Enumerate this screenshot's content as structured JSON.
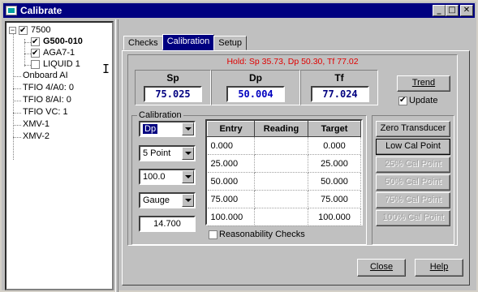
{
  "window": {
    "title": "Calibrate",
    "buttons": {
      "minimize": "_",
      "maximize": "□",
      "close": "✕"
    }
  },
  "tree": {
    "root": {
      "label": "7500",
      "checked": true
    },
    "items": [
      {
        "label": "G500-010",
        "checked": true,
        "bold": true
      },
      {
        "label": "AGA7-1",
        "checked": true,
        "bold": false
      },
      {
        "label": "LIQUID 1",
        "checked": false,
        "bold": false
      },
      {
        "label": "Onboard AI"
      },
      {
        "label": "TFIO 4/A0: 0"
      },
      {
        "label": "TFIO 8/AI: 0"
      },
      {
        "label": "TFIO VC: 1"
      },
      {
        "label": "XMV-1"
      },
      {
        "label": "XMV-2"
      }
    ]
  },
  "tabs": [
    {
      "label": "Checks",
      "active": false
    },
    {
      "label": "Calibration",
      "active": true
    },
    {
      "label": "Setup",
      "active": false
    }
  ],
  "hold_text": "Hold: Sp 35.73, Dp 50.30, Tf 77.02",
  "hold_color": "#e00000",
  "pv": {
    "sp": {
      "label": "Sp",
      "value": "75.025"
    },
    "dp": {
      "label": "Dp",
      "value": "50.004"
    },
    "tf": {
      "label": "Tf",
      "value": "77.024"
    }
  },
  "trend_button": "Trend",
  "update": {
    "label": "Update",
    "checked": true
  },
  "calibration": {
    "group_label": "Calibration",
    "variable": "Dp",
    "points": "5 Point",
    "range": "100.0",
    "pressure_type": "Gauge",
    "atm_value": "14.700"
  },
  "grid": {
    "headers": {
      "entry": "Entry",
      "reading": "Reading",
      "target": "Target"
    },
    "rows": [
      {
        "entry": "0.000",
        "reading": "",
        "target": "0.000"
      },
      {
        "entry": "25.000",
        "reading": "",
        "target": "25.000"
      },
      {
        "entry": "50.000",
        "reading": "",
        "target": "50.000"
      },
      {
        "entry": "75.000",
        "reading": "",
        "target": "75.000"
      },
      {
        "entry": "100.000",
        "reading": "",
        "target": "100.000"
      }
    ]
  },
  "reasonability": {
    "label": "Reasonability Checks",
    "checked": false
  },
  "side_buttons": [
    {
      "label": "Zero Transducer",
      "enabled": true
    },
    {
      "label": "Low Cal Point",
      "enabled": true
    },
    {
      "label": "25% Cal Point",
      "enabled": false
    },
    {
      "label": "50% Cal Point",
      "enabled": false
    },
    {
      "label": "75% Cal Point",
      "enabled": false
    },
    {
      "label": "100% Cal Point",
      "enabled": false
    }
  ],
  "footer": {
    "close": "Close",
    "help": "Help"
  },
  "icons": {
    "title": "app-icon",
    "tree_expand": "minus-box-icon",
    "check": "checkmark-icon",
    "dropdown": "chevron-down-icon",
    "cursor": "ibeam-cursor-icon"
  }
}
